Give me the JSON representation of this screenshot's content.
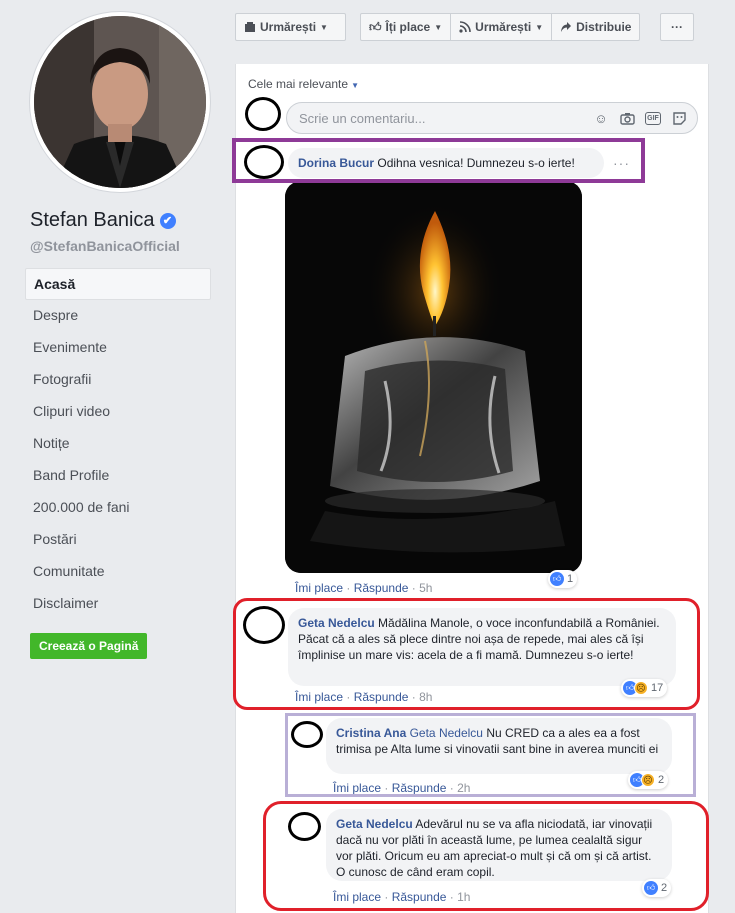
{
  "page": {
    "name": "Stefan Banica",
    "handle": "@StefanBanicaOfficial",
    "verified_glyph": "✔"
  },
  "nav": [
    {
      "label": "Acasă",
      "active": true
    },
    {
      "label": "Despre"
    },
    {
      "label": "Evenimente"
    },
    {
      "label": "Fotografii"
    },
    {
      "label": "Clipuri video"
    },
    {
      "label": "Notițe"
    },
    {
      "label": "Band Profile"
    },
    {
      "label": "200.000 de fani"
    },
    {
      "label": "Postări"
    },
    {
      "label": "Comunitate"
    },
    {
      "label": "Disclaimer"
    }
  ],
  "create_page_label": "Creează o Pagină",
  "toolbar": {
    "follow_label": "Urmărești",
    "like_label": "Îți place",
    "follow2_label": "Urmărești",
    "share_label": "Distribuie",
    "more_label": "···"
  },
  "feed": {
    "sort_label": "Cele mai relevante",
    "comment_placeholder": "Scrie un comentariu...",
    "gif_label": "GIF"
  },
  "comments": [
    {
      "author": "Dorina Bucur",
      "text": "Odihna vesnica! Dumnezeu s-o ierte!",
      "like": "Îmi place",
      "reply": "Răspunde",
      "time": "5h",
      "reactions": "1"
    },
    {
      "author": "Geta Nedelcu",
      "text": "Mădălina Manole, o voce inconfundabilă a României. Păcat că a ales să plece dintre noi așa de repede, mai ales că își împlinise un mare vis: acela de a fi mamă. Dumnezeu s-o ierte!",
      "like": "Îmi place",
      "reply": "Răspunde",
      "time": "8h",
      "reactions": "17"
    },
    {
      "author": "Cristina Ana",
      "mention": "Geta Nedelcu",
      "text": "Nu CRED ca a ales ea a fost trimisa pe Alta lume si vinovatii sant bine in averea munciti ei",
      "like": "Îmi place",
      "reply": "Răspunde",
      "time": "2h",
      "reactions": "2"
    },
    {
      "author": "Geta Nedelcu",
      "text": "Adevărul nu se va afla niciodată, iar vinovații dacă nu vor plăti în această lume, pe lumea cealaltă sigur vor plăti. Oricum eu am apreciat-o mult și că om și că artist. O cunosc de când eram copil.",
      "like": "Îmi place",
      "reply": "Răspunde",
      "time": "1h",
      "reactions": "2"
    }
  ],
  "colors": {
    "highlight_purple": "#8e3a97",
    "highlight_red": "#e0202a",
    "highlight_lavender": "#b9afd6",
    "link_blue": "#385898"
  }
}
